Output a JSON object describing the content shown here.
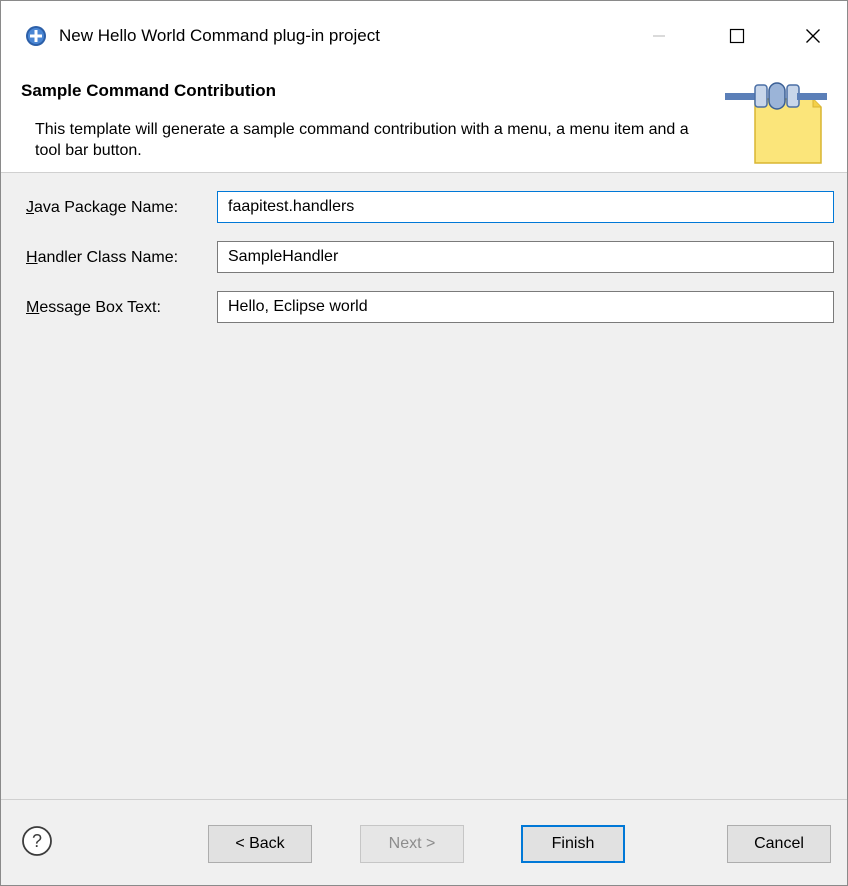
{
  "window": {
    "title": "New Hello World Command plug-in project"
  },
  "banner": {
    "title": "Sample Command Contribution",
    "description": "This template will generate a sample command contribution with a menu, a menu item and a tool bar button."
  },
  "form": {
    "fields": [
      {
        "label_accel": "J",
        "label_rest": "ava Package Name:",
        "value": "faapitest.handlers"
      },
      {
        "label_accel": "H",
        "label_rest": "andler Class Name:",
        "value": "SampleHandler"
      },
      {
        "label_accel": "M",
        "label_rest": "essage Box Text:",
        "value": "Hello, Eclipse world"
      }
    ]
  },
  "buttons": {
    "help_symbol": "?",
    "back": "< Back",
    "next": "Next >",
    "finish": "Finish",
    "cancel": "Cancel"
  },
  "colors": {
    "focus_border": "#0078d7",
    "button_face": "#e1e1e1",
    "dialog_bg": "#f0f0f0"
  },
  "icons": [
    "eclipse-app-icon",
    "minimize-icon",
    "maximize-icon",
    "close-icon",
    "plugin-wizard-icon",
    "help-icon"
  ]
}
